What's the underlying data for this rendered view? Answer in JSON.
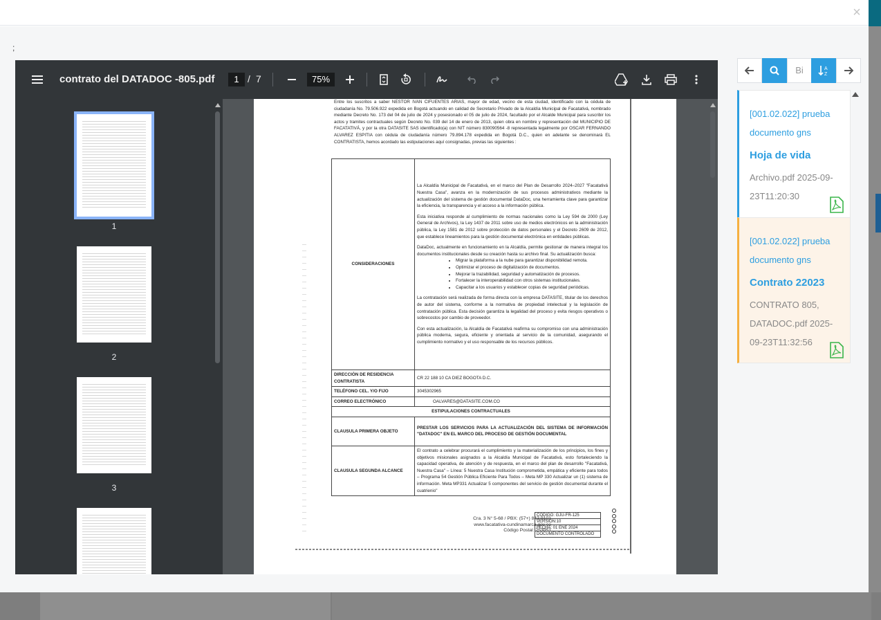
{
  "viewer": {
    "filename": "contrato del DATADOC -805.pdf",
    "current_page": "1",
    "page_separator": "/",
    "total_pages": "7",
    "zoom": "75%",
    "thumbnails": [
      "1",
      "2",
      "3",
      ""
    ]
  },
  "modal": {
    "close": "×",
    "semicolon": ";"
  },
  "document": {
    "intro": "Entre los suscritos a saber NESTOR IVAN CIFUENTES ARIAS, mayor de edad, vecino de esta ciudad, identificado con la cédula de ciudadanía No. 79.506.922 expedida en Bogotá actuando en calidad de Secretario Privado de la Alcaldía Municipal de Facatativá, nombrado mediante Decreto No. 173 del 04 de julio de 2024 y posesionado el 05 de julio de 2024, facultado por el Alcalde Municipal para suscribir los actos y tramites contractuales según Decreto No. 039 del 14 de enero de 2013, quien obra en nombre y representación del MUNICIPIO DE FACATATIVÁ, y por la otra DATASITE SAS identificado(a) con NIT número 830090564 -8 representada legalmente por OSCAR FERNANDO ALVAREZ ESPITIA con cédula de ciudadanía número 79.894.178 expedida en Bogotá D.C., quien en adelante se denominará EL CONTRATISTA, hemos acordado las estipulaciones aquí consignadas, previas las siguientes :",
    "considerations_label": "CONSIDERACIONES",
    "considerations": [
      "La Alcaldía Municipal de Facatativá, en el marco del Plan de Desarrollo 2024–2027 \"Facatativá Nuestra Casa\", avanza en la modernización de sus procesos administrativos mediante la actualización del sistema de gestión documental DataDoc, una herramienta clave para garantizar la eficiencia, la transparencia y el acceso a la información pública.",
      "Esta iniciativa responde al cumplimiento de normas nacionales como la Ley 594 de 2000 (Ley General de Archivos), la Ley 1437 de 2011 sobre uso de medios electrónicos en la administración pública, la Ley 1581 de 2012 sobre protección de datos personales y el Decreto 2609 de 2012, que establece lineamientos para la gestión documental electrónica en entidades públicas.",
      "DataDoc, actualmente en funcionamiento en la Alcaldía, permite gestionar de manera integral los documentos institucionales desde su creación hasta su archivo final. Su actualización busca:"
    ],
    "bullets": [
      "Migrar la plataforma a la nube para garantizar disponibilidad remota.",
      "Optimizar el proceso de digitalización de documentos.",
      "Mejorar la trazabilidad, seguridad y automatización de procesos.",
      "Fortalecer la interoperabilidad con otros sistemas institucionales.",
      "Capacitar a los usuarios y establecer copias de seguridad periódicas."
    ],
    "considerations_tail": [
      "La contratación será realizada de forma directa con la empresa DATASITE, titular de los derechos de autor del sistema, conforme a la normativa de propiedad intelectual y la legislación de contratación pública. Esta decisión garantiza la legalidad del proceso y evita riesgos operativos o sobrecostos por cambio de proveedor.",
      "Con esta actualización, la Alcaldía de Facatativá reafirma su compromiso con una administración pública moderna, segura, eficiente y orientada al servicio de la comunidad, asegurando el cumplimiento normativo y el uso responsable de los recursos públicos."
    ],
    "address_label": "DIRECCIÓN DE RESIDENCIA CONTRATISTA",
    "address": "CR 22 188 10 CA DIEZ  BOGOTA D.C.",
    "phone_label": "TELÉFONO CEL. Y/O FIJO",
    "phone": "3045302965",
    "email_label": "CORREO ELECTRÓNICO",
    "email": "OALVARES@DATASITE.COM.CO",
    "stipulations_header": "ESTIPULACIONES CONTRACTUALES",
    "object_label": "CLAUSULA PRIMERA OBJETO",
    "object": "PRESTAR LOS SERVICIOS PARA LA ACTUALIZACIÓN DEL SISTEMA DE INFORMACIÓN \"DATADOC\" EN EL MARCO DEL PROCESO DE GESTIÓN DOCUMENTAL",
    "scope_label": "CLAUSULA SEGUNDA ALCANCE",
    "scope": "El contrato a celebrar procurará el cumplimiento y la materialización de los principios, los fines y objetivos misionales asignados a la Alcaldía Municipal de Facatativá, esto fortaleciendo la capacidad operativa, de atención y de respuesta, en el marco del plan de desarrollo \"Facatativá, Nuestra Casa\" – Línea: 5 Nuestra Casa Institución comprometida, empática y eficiente para todos – Programa 54 Gestión Pública Eficiente Para Todos – Meta MP 330 Actualizar un (1) sistema de información. Meta MP331 Actualizar 5 componentes del servicio de gestión documental durante el cuatrienio\"",
    "footer_address": [
      "Cra. 3 N° 5-68 / PBX: (57+) 843 9101",
      "www.facatativa-cundinamarca.gov.co",
      "Código Postal: 253051"
    ],
    "footer_codes": [
      "CODIGO: GJU-FR-125",
      "VERSIÓN:10",
      "FECHA: 01 ENE 2024",
      "DOCUMENTO CONTROLADO"
    ]
  },
  "search_panel": {
    "search_value": "Bi",
    "results": [
      {
        "code": "[001.02.022] prueba documento gns",
        "name": "Hoja de vida",
        "file": "Archivo.pdf 2025-09-23T11:20:30"
      },
      {
        "code": "[001.02.022] prueba documento gns",
        "name": "Contrato 22023",
        "file": "CONTRATO 805, DATADOC.pdf 2025-09-23T11:32:56"
      }
    ]
  }
}
